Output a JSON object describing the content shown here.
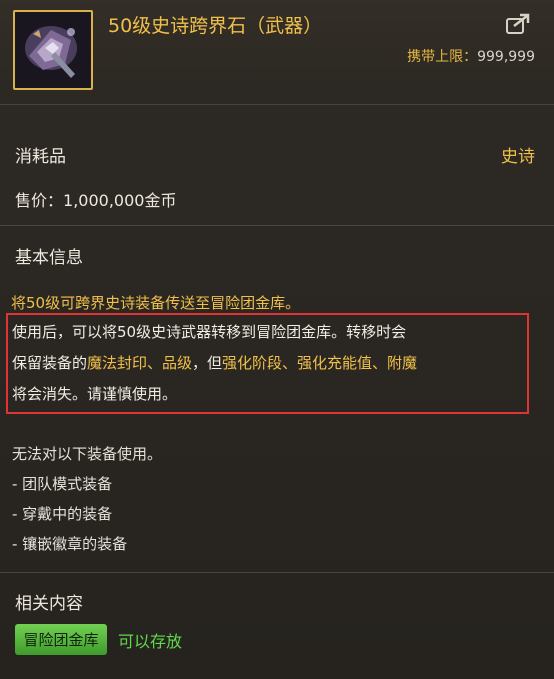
{
  "item": {
    "name": "50级史诗跨界石（武器）",
    "capacity_label": "携带上限：",
    "capacity_value": "999,999",
    "type": "消耗品",
    "rarity": "史诗",
    "price_label": "售价：",
    "price_value": "1,000,000金币"
  },
  "basic_info": {
    "heading": "基本信息",
    "summary": "将50级可跨界史诗装备传送至冒险团金库。",
    "desc": {
      "line1": "使用后，可以将50级史诗武器转移到冒险团金库。转移时会",
      "line2_a": "保留装备的",
      "line2_b": "魔法封印、品级",
      "line2_c": "，但",
      "line2_d": "强化阶段、强化充能值、附魔",
      "line3": "将会消失。请谨慎使用。"
    }
  },
  "restrictions": {
    "heading": "无法对以下装备使用。",
    "items": [
      "- 团队模式装备",
      "- 穿戴中的装备",
      "- 镶嵌徽章的装备"
    ]
  },
  "related": {
    "heading": "相关内容",
    "tag": "冒险团金库",
    "status": "可以存放"
  },
  "colors": {
    "title": "#f1c04a",
    "rarity": "#f1c04a",
    "highlight": "#f1c04a",
    "status_green": "#5fd94a",
    "warning_box": "#e03434"
  },
  "icons": {
    "share": "share-arrow-icon",
    "item": "epic-crossing-stone-icon"
  }
}
